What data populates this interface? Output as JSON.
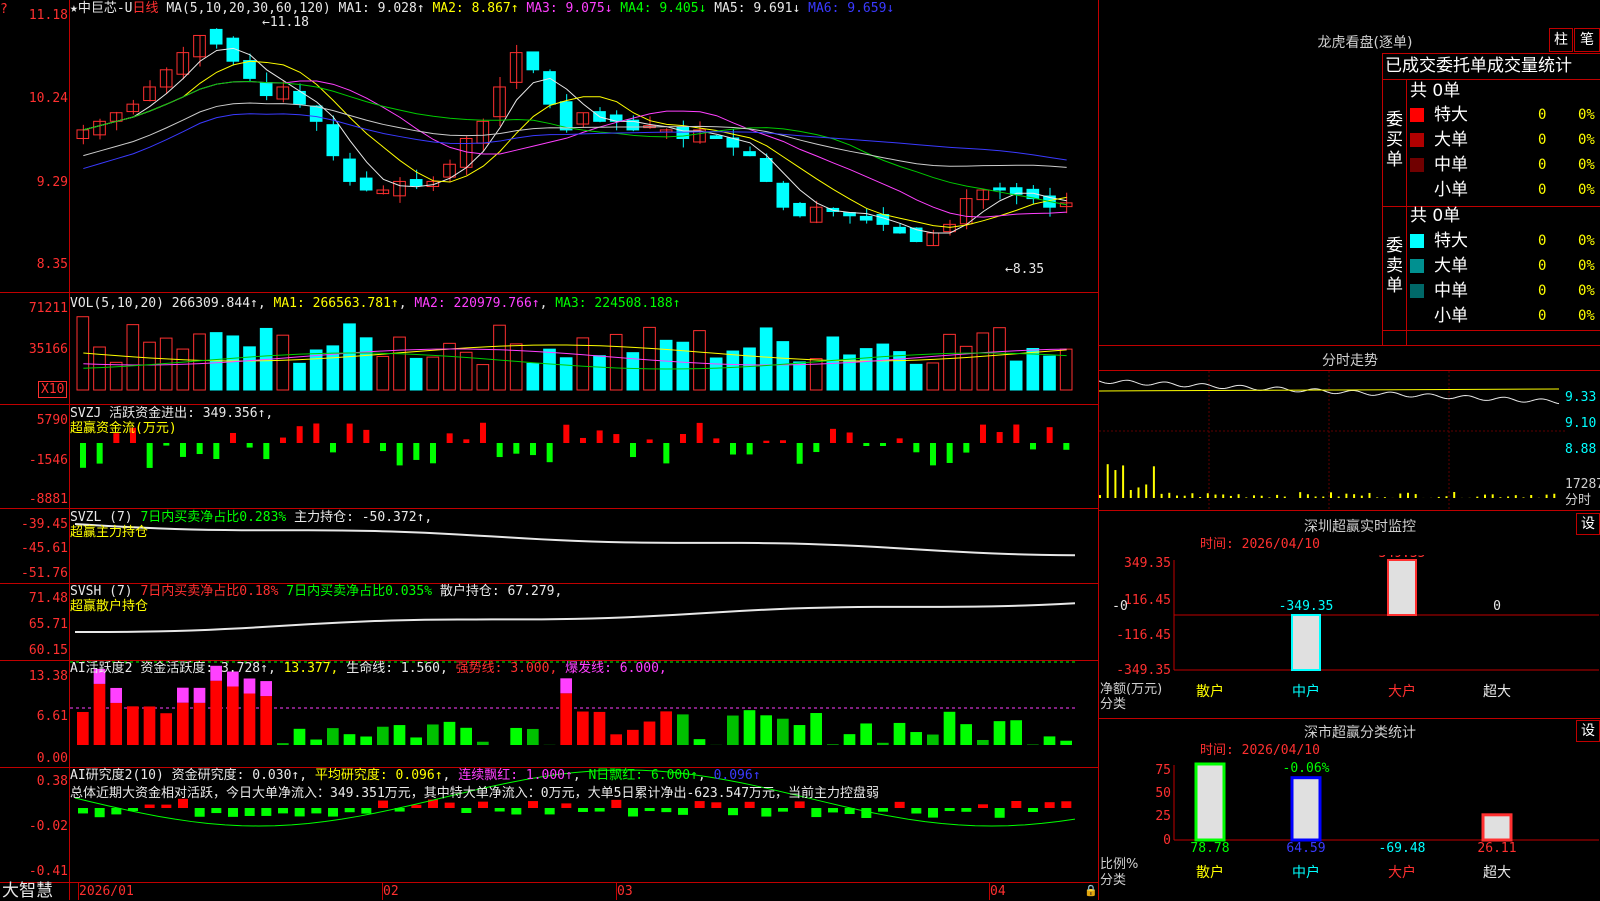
{
  "main": {
    "title": "★中巨芯-U",
    "period": "日线",
    "ma_text": "MA(5,10,20,30,60,120)",
    "ma1": "MA1: 9.028↑",
    "ma2": "MA2: 8.867↑",
    "ma3": "MA3: 9.075↓",
    "ma4": "MA4: 9.405↓",
    "ma5": "MA5: 9.691↓",
    "ma6": "MA6: 9.659↓",
    "axis": [
      "11.18",
      "10.24",
      "9.29",
      "8.35"
    ],
    "high_mark": "←11.18",
    "low_mark": "←8.35"
  },
  "vol": {
    "label": "VOL(5,10,20)",
    "value": "266309.844↑",
    "ma1": "MA1: 266563.781↑",
    "ma2": "MA2: 220979.766↑",
    "ma3": "MA3: 224508.188↑",
    "axis": [
      "71211",
      "35166"
    ],
    "unit": "X10"
  },
  "svzj": {
    "label": "SVZJ",
    "text": "活跃资金进出: 349.356↑",
    "subtitle": "超赢资金流(万元)",
    "axis": [
      "5790",
      "-1546",
      "-8881"
    ]
  },
  "svzl": {
    "label": "SVZL (7)",
    "text1": "7日内买卖净占比0.283%",
    "text2": "主力持仓: -50.372↑,",
    "subtitle": "超赢主力持仓",
    "axis": [
      "-39.45",
      "-45.61",
      "-51.76"
    ]
  },
  "svsh": {
    "label": "SVSH (7)",
    "text1": "7日内买卖净占比0.18%",
    "text2": "7日内买卖净占比0.035%",
    "text3": "散户持仓: 67.279,",
    "subtitle": "超赢散户持仓",
    "axis": [
      "71.48",
      "65.71",
      "60.15"
    ]
  },
  "ai1": {
    "label": "AI活跃度2",
    "t1": "资金活跃度: 3.728↑",
    "t2": "13.377,",
    "t3": "生命线: 1.560,",
    "t4": "强势线: 3.000,",
    "t5": "爆发线: 6.000,",
    "axis": [
      "13.38",
      "6.61",
      "0.00"
    ]
  },
  "ai2": {
    "label": "AI研究度2(10)",
    "t1": "资金研究度: 0.030↑",
    "t2": "平均研究度: 0.096↑",
    "t3": "连续飘红: 1.000↑",
    "t4": "N日飘红: 6.000↑",
    "t5": "0.096↑",
    "summary": "总体近期大资金相对活跃，今日大单净流入：349.351万元，其中特大单净流入：0万元，大单5日累计净出-623.547万元，当前主力控盘弱",
    "axis": [
      "0.38",
      "-0.02",
      "-0.41"
    ]
  },
  "bottom": {
    "brand": "大智慧",
    "dates": [
      "2026/01",
      "02",
      "03",
      "04"
    ]
  },
  "dragon": {
    "title": "龙虎看盘(逐单)",
    "btn1": "柱",
    "btn2": "笔",
    "subtitle": "已成交委托单成交量统计",
    "buy_label": "委买单",
    "sell_label": "委卖单",
    "buy_total": "共 0单",
    "sell_total": "共 0单",
    "buy_rows": [
      {
        "name": "特大",
        "num": "0",
        "pct": "0%",
        "color": "#ff0000"
      },
      {
        "name": "大单",
        "num": "0",
        "pct": "0%",
        "color": "#b00000"
      },
      {
        "name": "中单",
        "num": "0",
        "pct": "0%",
        "color": "#700000"
      },
      {
        "name": "小单",
        "num": "0",
        "pct": "0%",
        "color": "#000000"
      }
    ],
    "sell_rows": [
      {
        "name": "特大",
        "num": "0",
        "pct": "0%",
        "color": "#00ffff"
      },
      {
        "name": "大单",
        "num": "0",
        "pct": "0%",
        "color": "#009090"
      },
      {
        "name": "中单",
        "num": "0",
        "pct": "0%",
        "color": "#006868"
      },
      {
        "name": "小单",
        "num": "0",
        "pct": "0%",
        "color": "#000000"
      }
    ]
  },
  "intraday": {
    "title": "分时走势",
    "axis": [
      "9.33",
      "9.10",
      "8.88"
    ],
    "vol_label": "17287",
    "tag": "分时"
  },
  "monitor": {
    "title": "深圳超赢实时监控",
    "btn": "设",
    "time": "时间: 2026/04/10",
    "yaxis": [
      "349.35",
      "116.45",
      "-116.45",
      "-349.35"
    ],
    "bar_labels": [
      "-0",
      "-349.35",
      "349.35",
      "0"
    ],
    "side1": "净额(万元)",
    "side2": "分类",
    "categories": [
      "散户",
      "中户",
      "大户",
      "超大"
    ],
    "values": [
      0,
      -349.35,
      349.35,
      0
    ]
  },
  "classify": {
    "title": "深市超赢分类统计",
    "btn": "设",
    "time": "时间: 2026/04/10",
    "yaxis": [
      "75",
      "50",
      "25",
      "0"
    ],
    "top_label": "-0.06%",
    "values_text": [
      "78.78",
      "64.59",
      "-69.48",
      "26.11"
    ],
    "side1": "比例%",
    "side2": "分类",
    "categories": [
      "散户",
      "中户",
      "大户",
      "超大"
    ],
    "values": [
      78.78,
      64.59,
      -69.48,
      26.11
    ]
  },
  "colors": {
    "up": "#ff3030",
    "down": "#00ffff",
    "frame": "#c00000"
  }
}
